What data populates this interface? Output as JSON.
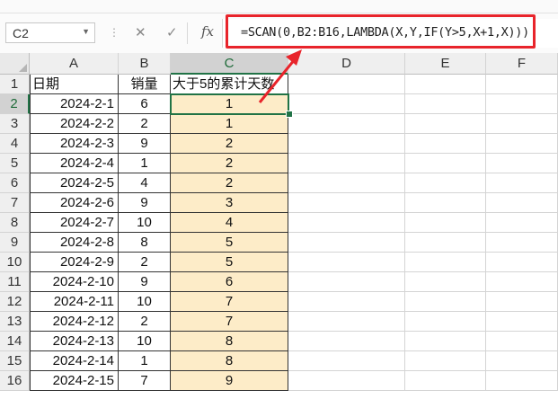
{
  "name_box": {
    "value": "C2"
  },
  "formula": "=SCAN(0,B2:B16,LAMBDA(X,Y,IF(Y>5,X+1,X)))",
  "buttons": {
    "cancel": "✕",
    "enter": "✓",
    "fx": "fx"
  },
  "columns": [
    "A",
    "B",
    "C",
    "D",
    "E",
    "F"
  ],
  "headers": {
    "a": "日期",
    "b": "销量",
    "c": "大于5的累计天数"
  },
  "rows": [
    {
      "n": "1"
    },
    {
      "n": "2",
      "date": "2024-2-1",
      "sales": "6",
      "count": "1"
    },
    {
      "n": "3",
      "date": "2024-2-2",
      "sales": "2",
      "count": "1"
    },
    {
      "n": "4",
      "date": "2024-2-3",
      "sales": "9",
      "count": "2"
    },
    {
      "n": "5",
      "date": "2024-2-4",
      "sales": "1",
      "count": "2"
    },
    {
      "n": "6",
      "date": "2024-2-5",
      "sales": "4",
      "count": "2"
    },
    {
      "n": "7",
      "date": "2024-2-6",
      "sales": "9",
      "count": "3"
    },
    {
      "n": "8",
      "date": "2024-2-7",
      "sales": "10",
      "count": "4"
    },
    {
      "n": "9",
      "date": "2024-2-8",
      "sales": "8",
      "count": "5"
    },
    {
      "n": "10",
      "date": "2024-2-9",
      "sales": "2",
      "count": "5"
    },
    {
      "n": "11",
      "date": "2024-2-10",
      "sales": "9",
      "count": "6"
    },
    {
      "n": "12",
      "date": "2024-2-11",
      "sales": "10",
      "count": "7"
    },
    {
      "n": "13",
      "date": "2024-2-12",
      "sales": "2",
      "count": "7"
    },
    {
      "n": "14",
      "date": "2024-2-13",
      "sales": "10",
      "count": "8"
    },
    {
      "n": "15",
      "date": "2024-2-14",
      "sales": "1",
      "count": "8"
    },
    {
      "n": "16",
      "date": "2024-2-15",
      "sales": "7",
      "count": "9"
    }
  ],
  "colors": {
    "accent": "#217346",
    "highlight_fill": "#fdecc8",
    "annotation": "#e8242b"
  }
}
